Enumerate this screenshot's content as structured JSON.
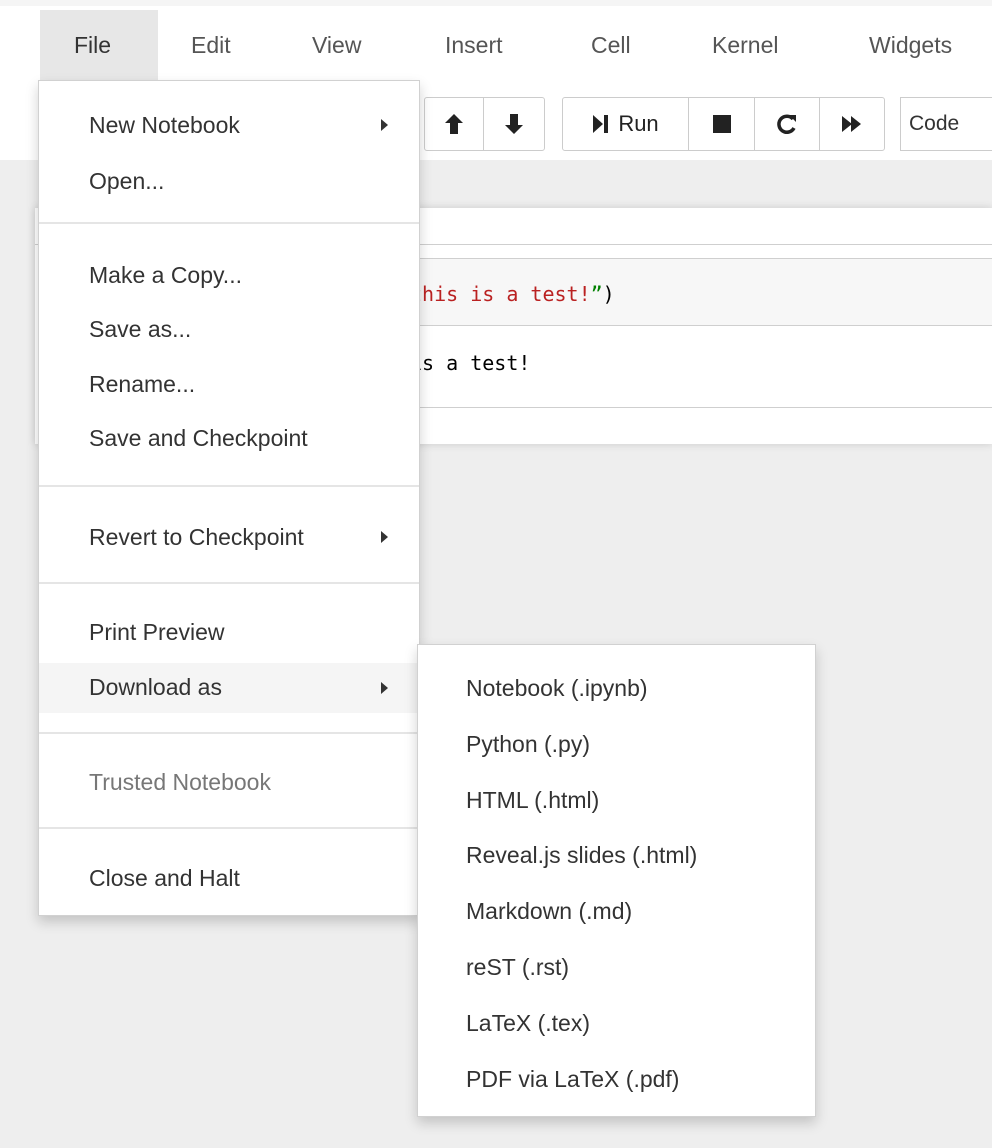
{
  "menubar": {
    "items": [
      {
        "label": "File"
      },
      {
        "label": "Edit"
      },
      {
        "label": "View"
      },
      {
        "label": "Insert"
      },
      {
        "label": "Cell"
      },
      {
        "label": "Kernel"
      },
      {
        "label": "Widgets"
      }
    ]
  },
  "toolbar": {
    "run_label": "Run",
    "cell_type_value": "Code"
  },
  "notebook": {
    "input_code_visible": "this is a test!”)",
    "output_visible": "is a test!"
  },
  "file_menu": {
    "items": [
      {
        "label": "New Notebook"
      },
      {
        "label": "Open..."
      },
      {
        "label": "Make a Copy..."
      },
      {
        "label": "Save as..."
      },
      {
        "label": "Rename..."
      },
      {
        "label": "Save and Checkpoint"
      },
      {
        "label": "Revert to Checkpoint"
      },
      {
        "label": "Print Preview"
      },
      {
        "label": "Download as"
      },
      {
        "label": "Trusted Notebook"
      },
      {
        "label": "Close and Halt"
      }
    ]
  },
  "download_submenu": {
    "items": [
      {
        "label": "Notebook (.ipynb)"
      },
      {
        "label": "Python (.py)"
      },
      {
        "label": "HTML (.html)"
      },
      {
        "label": "Reveal.js slides (.html)"
      },
      {
        "label": "Markdown (.md)"
      },
      {
        "label": "reST (.rst)"
      },
      {
        "label": "LaTeX (.tex)"
      },
      {
        "label": "PDF via LaTeX (.pdf)"
      }
    ]
  },
  "colors": {
    "string_red": "#ba2121",
    "quote_green": "#008000",
    "menu_text": "#333333"
  }
}
